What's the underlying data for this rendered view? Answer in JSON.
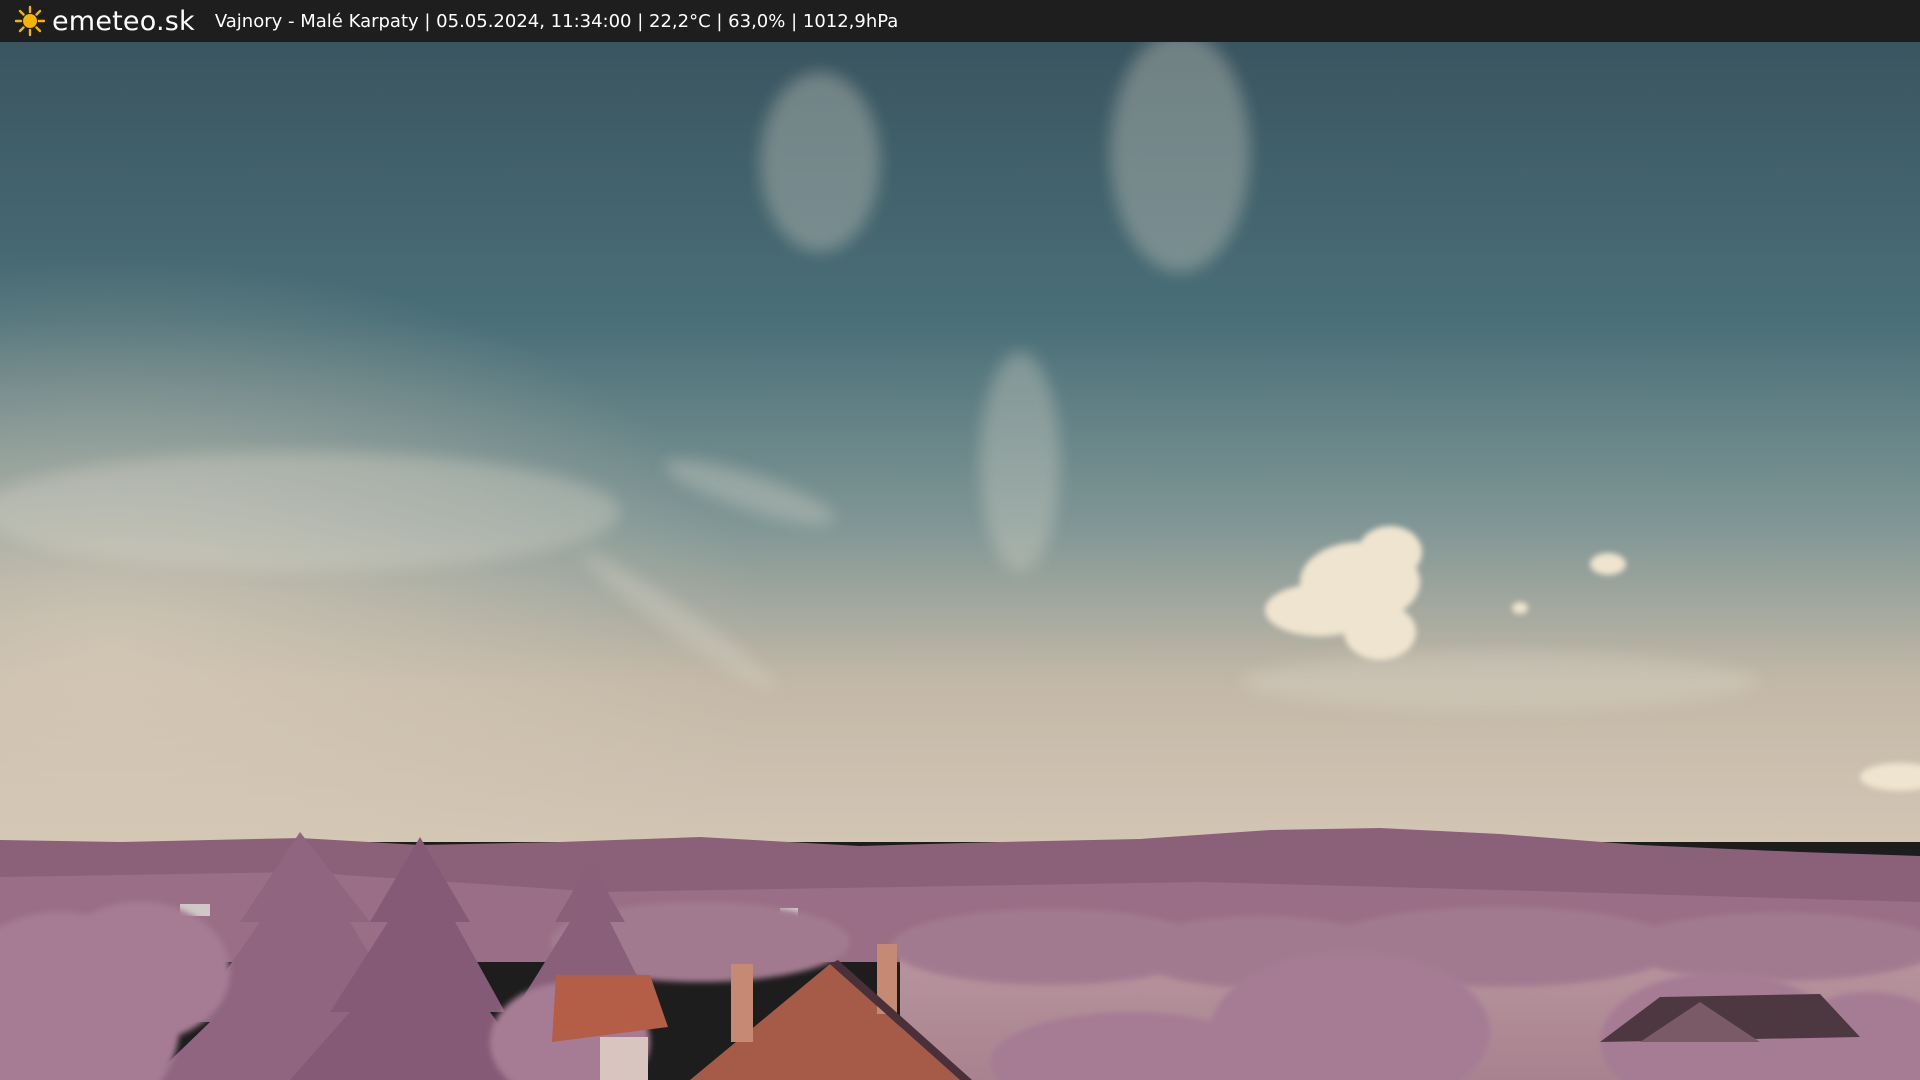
{
  "header": {
    "logo_icon": "sun-icon",
    "brand": "emeteo.sk",
    "caption": "Vajnory - Malé Karpaty | 05.05.2024, 11:34:00 | 22,2°C | 63,0% | 1012,9hPa"
  },
  "colors": {
    "bar_background": "#1e1e1e",
    "bar_text": "#ffffff",
    "sun": "#f5b400",
    "sky_top": "#3c5a66",
    "sky_horizon": "#cdbfae",
    "hills": "#8a5f78",
    "foliage": "#a87f96",
    "roof": "#b85f45"
  }
}
